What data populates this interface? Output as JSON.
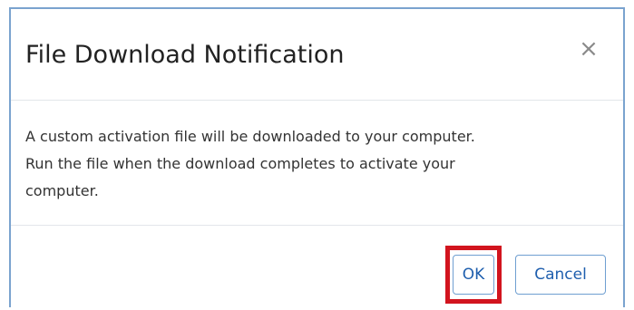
{
  "dialog": {
    "title": "File Download Notification",
    "close_label": "×",
    "body_lines": [
      "A custom activation file will be downloaded to your computer.",
      "Run the file when the download completes to activate your",
      "computer."
    ],
    "buttons": {
      "ok_label": "OK",
      "cancel_label": "Cancel"
    }
  },
  "colors": {
    "border": "#7aa3cf",
    "button_text": "#1f5fae",
    "highlight": "#d2141e"
  }
}
